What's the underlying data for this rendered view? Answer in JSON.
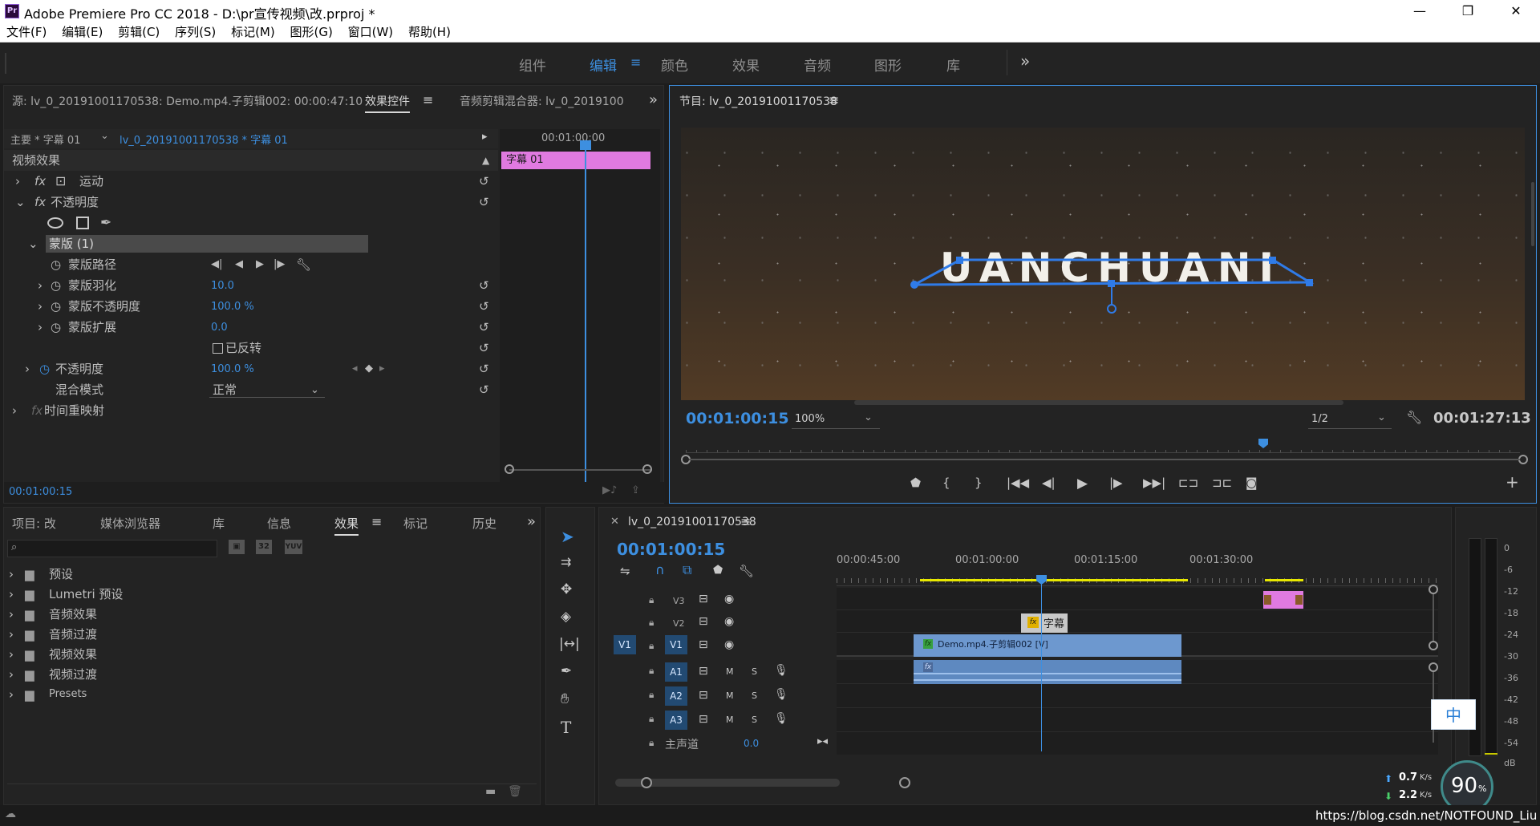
{
  "window": {
    "title": "Adobe Premiere Pro CC 2018 - D:\\pr宣传视频\\改.prproj *",
    "app_icon": "Pr",
    "controls": {
      "minimize": "—",
      "maximize": "❐",
      "close": "✕"
    }
  },
  "menu": [
    "文件(F)",
    "编辑(E)",
    "剪辑(C)",
    "序列(S)",
    "标记(M)",
    "图形(G)",
    "窗口(W)",
    "帮助(H)"
  ],
  "workspaces": {
    "tabs": [
      "组件",
      "编辑",
      "颜色",
      "效果",
      "音频",
      "图形",
      "库"
    ],
    "active": "编辑",
    "menu_glyph": "≡",
    "more": "»"
  },
  "source_panel": {
    "tabs": [
      "源: lv_0_20191001170538: Demo.mp4.子剪辑002: 00:00:47:10",
      "效果控件",
      "音频剪辑混合器: lv_0_2019100"
    ],
    "active_tab": "效果控件",
    "clip_path_main": "主要 * 字幕 01",
    "clip_path_seq": "lv_0_20191001170538 * 字幕 01",
    "mini_timecode": "00:01:00:00",
    "mini_clip_label": "字幕 01",
    "section_video": "视频效果",
    "fx_motion": "运动",
    "fx_opacity": "不透明度",
    "mask_group": "蒙版 (1)",
    "mask_path": "蒙版路径",
    "mask_feather": {
      "label": "蒙版羽化",
      "value": "10.0"
    },
    "mask_opacity": {
      "label": "蒙版不透明度",
      "value": "100.0 %"
    },
    "mask_expansion": {
      "label": "蒙版扩展",
      "value": "0.0"
    },
    "inverted": "已反转",
    "opacity": {
      "label": "不透明度",
      "value": "100.0 %"
    },
    "blend_mode": {
      "label": "混合模式",
      "value": "正常"
    },
    "time_remap": "时间重映射",
    "fx_symbol": "fx",
    "timecode": "00:01:00:15"
  },
  "program_panel": {
    "title": "节目: lv_0_20191001170538",
    "current_tc": "00:01:00:15",
    "zoom": "100%",
    "resolution": "1/2",
    "duration_tc": "00:01:27:13",
    "video_text": "UANCHUANI"
  },
  "project_panel": {
    "tabs": [
      "项目: 改",
      "媒体浏览器",
      "库",
      "信息",
      "效果",
      "标记",
      "历史"
    ],
    "active_tab": "效果",
    "buttons": [
      "32",
      "YUV"
    ],
    "folders": [
      "预设",
      "Lumetri 预设",
      "音频效果",
      "音频过渡",
      "视频效果",
      "视频过渡",
      "Presets"
    ]
  },
  "timeline": {
    "title": "lv_0_20191001170538",
    "timecode": "00:01:00:15",
    "ruler": [
      "00:00:45:00",
      "00:01:00:00",
      "00:01:15:00",
      "00:01:30:00"
    ],
    "video_tracks": [
      "V3",
      "V2",
      "V1"
    ],
    "audio_tracks": [
      "A1",
      "A2",
      "A3"
    ],
    "source_patch_v": "V1",
    "mute": "M",
    "solo": "S",
    "master_label": "主声道",
    "master_value": "0.0",
    "clip_v1": "Demo.mp4.子剪辑002 [V]",
    "clip_v2": "字幕"
  },
  "vu_meter": {
    "scale": [
      "0",
      "-6",
      "-12",
      "-18",
      "-24",
      "-30",
      "-36",
      "-42",
      "-48",
      "-54",
      "dB"
    ]
  },
  "overlays": {
    "ime": "中",
    "net_up": "0.7",
    "net_down": "2.2",
    "net_unit": "K/s",
    "cpu_percent": "90",
    "cpu_unit": "%",
    "watermark": "https://blog.csdn.net/NOTFOUND_Liu"
  },
  "colors": {
    "accent": "#3d8fe0",
    "clip_pink": "#e07ae0",
    "clip_blue": "#6d98cf",
    "track_patch": "#224a72",
    "mask_outline": "#2f7be8"
  }
}
